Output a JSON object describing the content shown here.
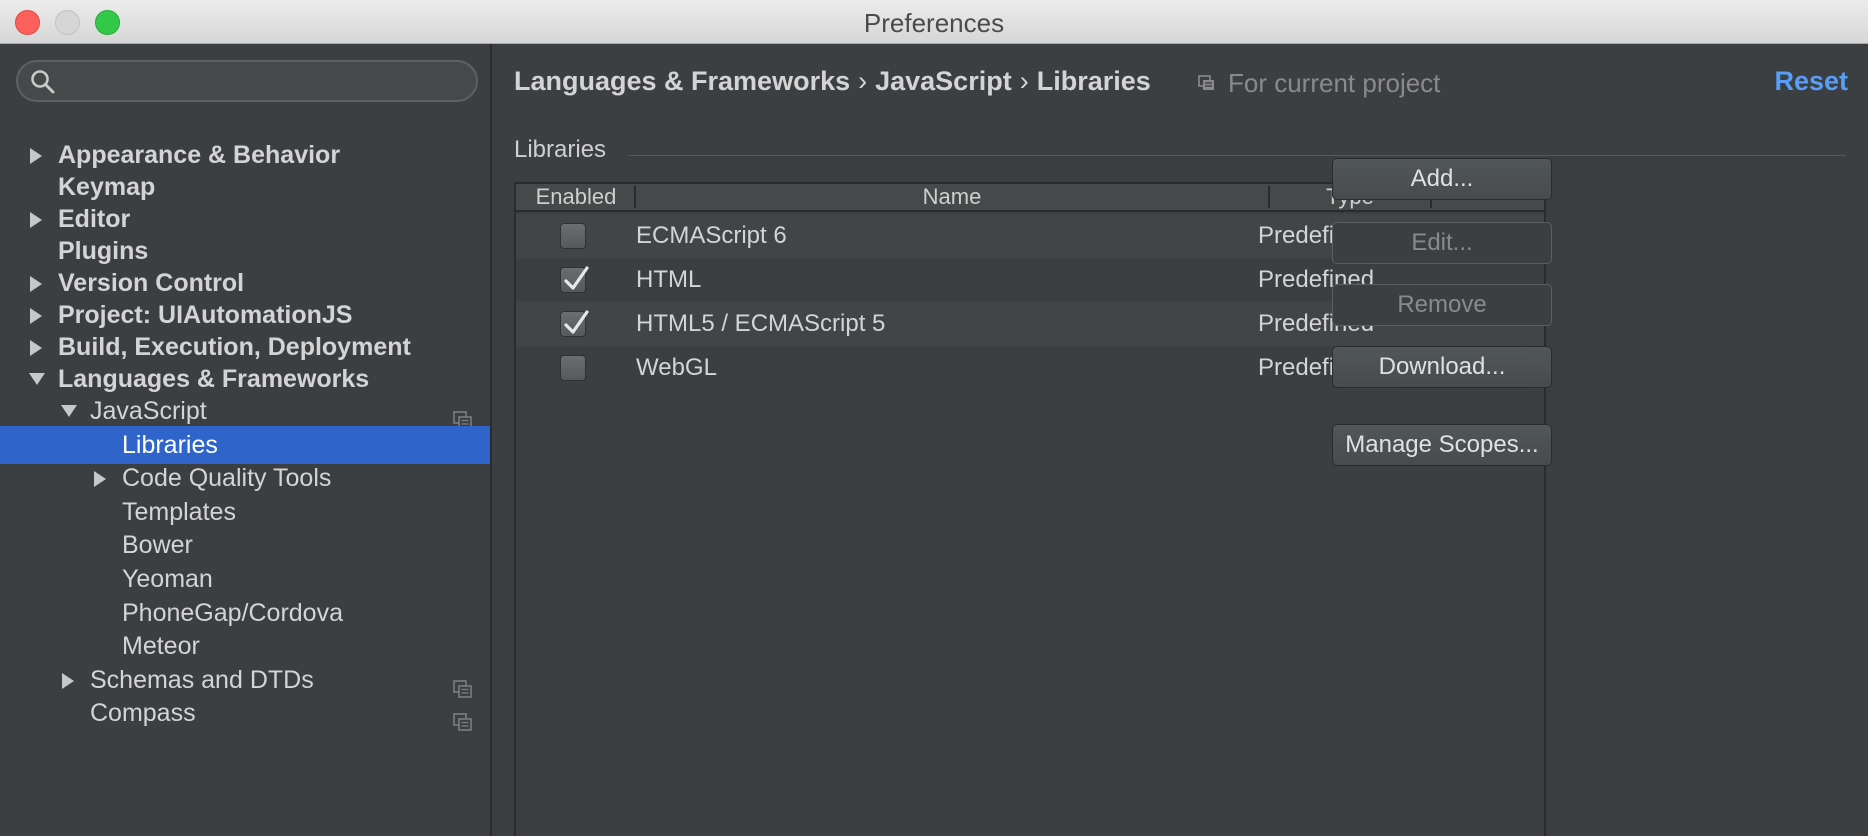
{
  "window": {
    "title": "Preferences"
  },
  "search": {
    "placeholder": "",
    "value": ""
  },
  "sidebar": {
    "items": [
      {
        "label": "Appearance & Behavior",
        "level": 0,
        "expander": "collapsed",
        "bold": true
      },
      {
        "label": "Keymap",
        "level": 0,
        "expander": "none",
        "bold": true
      },
      {
        "label": "Editor",
        "level": 0,
        "expander": "collapsed",
        "bold": true
      },
      {
        "label": "Plugins",
        "level": 0,
        "expander": "none",
        "bold": true
      },
      {
        "label": "Version Control",
        "level": 0,
        "expander": "collapsed",
        "bold": true
      },
      {
        "label": "Project: UIAutomationJS",
        "level": 0,
        "expander": "collapsed",
        "bold": true
      },
      {
        "label": "Build, Execution, Deployment",
        "level": 0,
        "expander": "collapsed",
        "bold": true
      },
      {
        "label": "Languages & Frameworks",
        "level": 0,
        "expander": "expanded",
        "bold": true
      },
      {
        "label": "JavaScript",
        "level": 1,
        "expander": "expanded",
        "project_icon": true
      },
      {
        "label": "Libraries",
        "level": 2,
        "expander": "none",
        "selected": true
      },
      {
        "label": "Code Quality Tools",
        "level": 2,
        "expander": "collapsed"
      },
      {
        "label": "Templates",
        "level": 2,
        "expander": "none"
      },
      {
        "label": "Bower",
        "level": 2,
        "expander": "none"
      },
      {
        "label": "Yeoman",
        "level": 2,
        "expander": "none"
      },
      {
        "label": "PhoneGap/Cordova",
        "level": 2,
        "expander": "none"
      },
      {
        "label": "Meteor",
        "level": 2,
        "expander": "none"
      },
      {
        "label": "Schemas and DTDs",
        "level": 1,
        "expander": "collapsed",
        "project_icon": true
      },
      {
        "label": "Compass",
        "level": 1,
        "expander": "none",
        "project_icon": true
      }
    ]
  },
  "header": {
    "breadcrumb": [
      "Languages & Frameworks",
      "JavaScript",
      "Libraries"
    ],
    "separator": "›",
    "scope_icon": "project-scope-icon",
    "scope_label": "For current project",
    "reset_label": "Reset"
  },
  "libraries": {
    "section_title": "Libraries",
    "columns": [
      "Enabled",
      "Name",
      "Type"
    ],
    "rows": [
      {
        "enabled": false,
        "name": "ECMAScript 6",
        "type": "Predefined"
      },
      {
        "enabled": true,
        "name": "HTML",
        "type": "Predefined"
      },
      {
        "enabled": true,
        "name": "HTML5 / ECMAScript 5",
        "type": "Predefined"
      },
      {
        "enabled": false,
        "name": "WebGL",
        "type": "Predefined"
      }
    ]
  },
  "buttons": {
    "add": {
      "label": "Add...",
      "enabled": true
    },
    "edit": {
      "label": "Edit...",
      "enabled": false
    },
    "remove": {
      "label": "Remove",
      "enabled": false
    },
    "download": {
      "label": "Download...",
      "enabled": true
    },
    "manage_scopes": {
      "label": "Manage Scopes...",
      "enabled": true
    }
  },
  "colors": {
    "background": "#3c3f41",
    "selection": "#2f65ca",
    "link": "#589df6",
    "text": "#d4d4d4"
  }
}
